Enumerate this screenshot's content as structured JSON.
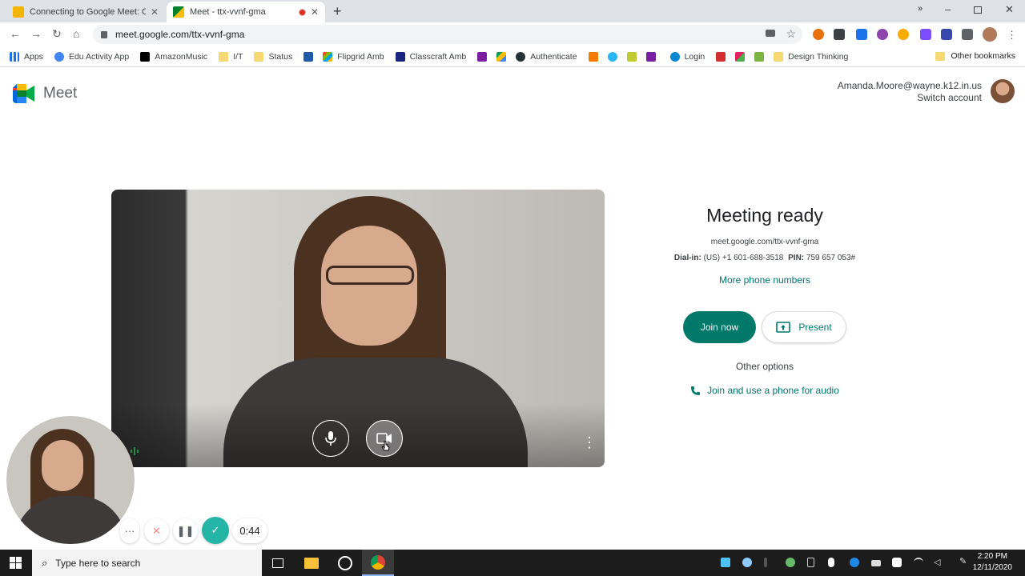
{
  "browser": {
    "tabs": [
      {
        "title": "Connecting to Google Meet: Can",
        "close": "✕"
      },
      {
        "title": "Meet - ttx-vvnf-gma",
        "close": "✕"
      }
    ],
    "new_tab": "+",
    "url": "meet.google.com/ttx-vvnf-gma",
    "bookmarks": [
      "Apps",
      "Edu Activity App",
      "AmazonMusic",
      "I/T",
      "Status",
      "Flipgrid Amb",
      "Classcraft Amb",
      "Authenticate",
      "Login",
      "Design Thinking"
    ],
    "bookmarks_overflow": "»",
    "other_bookmarks": "Other bookmarks"
  },
  "meet": {
    "logo_text": "Meet",
    "account_email": "Amanda.Moore@wayne.k12.in.us",
    "switch_account": "Switch account",
    "title": "Meeting ready",
    "meeting_url": "meet.google.com/ttx-vvnf-gma",
    "dial_label": "Dial-in:",
    "dial_number": "(US) +1 601-688-3518",
    "pin_label": "PIN:",
    "pin": "759 657 053#",
    "more_phone": "More phone numbers",
    "join_now": "Join now",
    "present": "Present",
    "other_options": "Other options",
    "phone_audio": "Join and use a phone for audio"
  },
  "recorder": {
    "more": "···",
    "cancel": "✕",
    "pause": "❚❚",
    "done": "✓",
    "time": "0:44"
  },
  "taskbar": {
    "search_placeholder": "Type here to search",
    "time": "2:20 PM",
    "date": "12/11/2020"
  },
  "colors": {
    "accent": "#00796b",
    "tabstrip": "#dee1e6",
    "taskbar": "#1c1c1c"
  }
}
